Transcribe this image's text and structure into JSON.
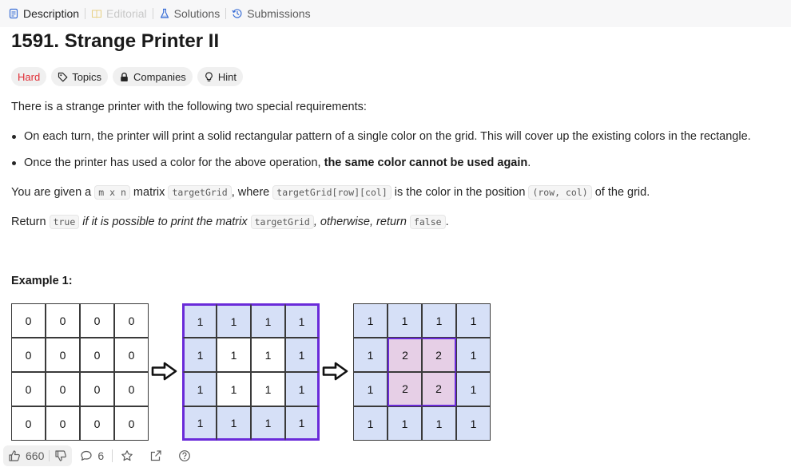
{
  "tabs": [
    {
      "label": "Description",
      "icon": "description-icon",
      "state": "active"
    },
    {
      "label": "Editorial",
      "icon": "book-icon",
      "state": "disabled"
    },
    {
      "label": "Solutions",
      "icon": "flask-icon",
      "state": "normal"
    },
    {
      "label": "Submissions",
      "icon": "history-icon",
      "state": "normal"
    }
  ],
  "problem": {
    "title": "1591. Strange Printer II",
    "difficulty": "Hard",
    "tags": [
      {
        "label": "Topics",
        "icon": "tag-icon"
      },
      {
        "label": "Companies",
        "icon": "lock-icon"
      },
      {
        "label": "Hint",
        "icon": "lightbulb-icon"
      }
    ]
  },
  "description": {
    "intro": "There is a strange printer with the following two special requirements:",
    "bullet1": "On each turn, the printer will print a solid rectangular pattern of a single color on the grid. This will cover up the existing colors in the rectangle.",
    "bullet2_pre": "Once the printer has used a color for the above operation, ",
    "bullet2_bold": "the same color cannot be used again",
    "bullet2_post": ".",
    "given": {
      "t1": "You are given a ",
      "c1": "m x n",
      "t2": " matrix ",
      "c2": "targetGrid",
      "t3": ", where ",
      "c3": "targetGrid[row][col]",
      "t4": " is the color in the position ",
      "c4": "(row, col)",
      "t5": " of the grid."
    },
    "ret": {
      "t1": "Return ",
      "c1": "true",
      "i1": " if it is possible to print the matrix ",
      "c2": "targetGrid",
      "i2": ", otherwise, return ",
      "c3": "false",
      "t2": "."
    }
  },
  "example": {
    "title": "Example 1:",
    "grids": [
      [
        [
          "0",
          "0",
          "0",
          "0"
        ],
        [
          "0",
          "0",
          "0",
          "0"
        ],
        [
          "0",
          "0",
          "0",
          "0"
        ],
        [
          "0",
          "0",
          "0",
          "0"
        ]
      ],
      [
        [
          "1",
          "1",
          "1",
          "1"
        ],
        [
          "1",
          "1",
          "1",
          "1"
        ],
        [
          "1",
          "1",
          "1",
          "1"
        ],
        [
          "1",
          "1",
          "1",
          "1"
        ]
      ],
      [
        [
          "1",
          "1",
          "1",
          "1"
        ],
        [
          "1",
          "2",
          "2",
          "1"
        ],
        [
          "1",
          "2",
          "2",
          "1"
        ],
        [
          "1",
          "1",
          "1",
          "1"
        ]
      ]
    ]
  },
  "footer": {
    "likes": "660",
    "comments": "6"
  },
  "colors": {
    "blue_fill": "#d6e0f7",
    "purple_border": "#6a2bd9",
    "pink_fill": "#e6cfe6",
    "hard": "#e02d35"
  }
}
